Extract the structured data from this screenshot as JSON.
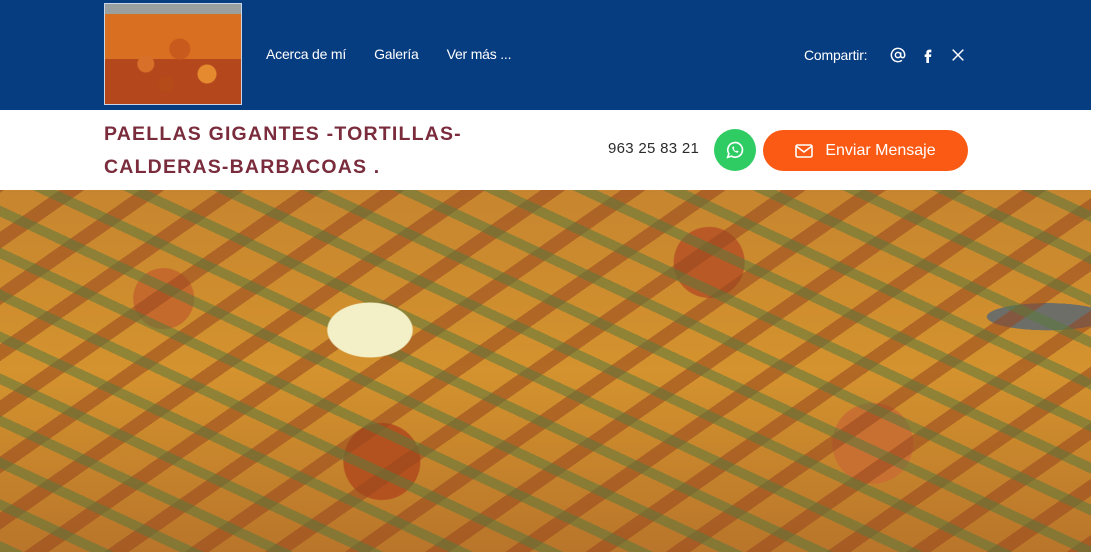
{
  "header": {
    "logo_alt": "Paella gigante",
    "nav": [
      {
        "label": "Acerca de mí"
      },
      {
        "label": "Galería"
      },
      {
        "label": "Ver más ..."
      }
    ],
    "share": {
      "label": "Compartir:",
      "icons": [
        "at-sign-icon",
        "facebook-icon",
        "x-icon"
      ]
    }
  },
  "business": {
    "title": "PAELLAS GIGANTES -TORTILLAS- CALDERAS-BARBACOAS .",
    "phone": "963 25 83 21",
    "send_button_label": "Enviar Mensaje"
  },
  "colors": {
    "header_bg": "#063c80",
    "title": "#7a2c3c",
    "whatsapp": "#2ecc63",
    "cta": "#fa5a14"
  }
}
